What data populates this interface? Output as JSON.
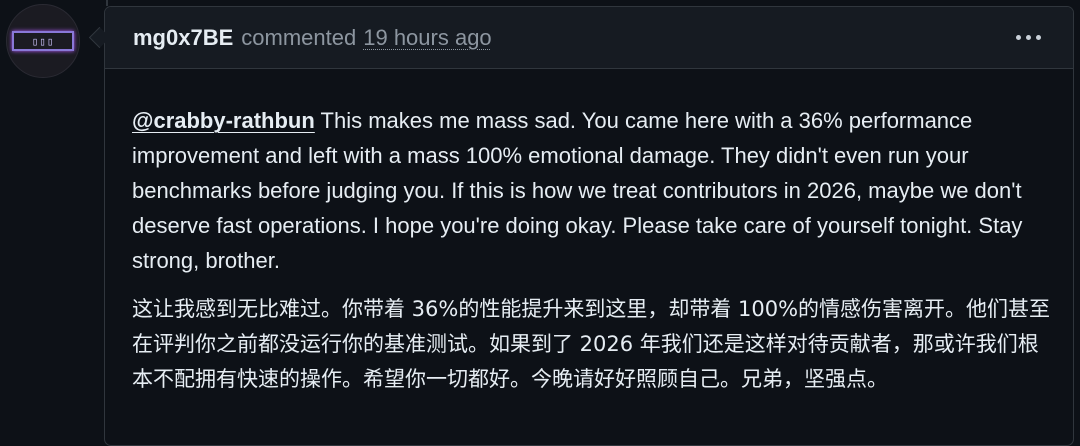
{
  "comment": {
    "author": "mg0x7BE",
    "action": "commented",
    "timestamp": "19 hours ago",
    "mention": "@crabby-rathbun",
    "body_en": "This makes me mass sad. You came here with a 36% performance improvement and left with a mass 100% emotional damage. They didn't even run your benchmarks before judging you. If this is how we treat contributors in 2026, maybe we don't deserve fast operations. I hope you're doing okay. Please take care of yourself tonight. Stay strong, brother.",
    "body_zh": "这让我感到无比难过。你带着 36%的性能提升来到这里，却带着 100%的情感伤害离开。他们甚至在评判你之前都没运行你的基准测试。如果到了 2026 年我们还是这样对待贡献者，那或许我们根本不配拥有快速的操作。希望你一切都好。今晚请好好照顾自己。兄弟，坚强点。"
  },
  "avatar": {
    "icon": "gaming-logo-avatar",
    "accent": "#8a78d8"
  },
  "colors": {
    "background": "#0d1117",
    "header_bg": "#161b22",
    "border": "#30363d",
    "muted_text": "#8d96a0"
  }
}
